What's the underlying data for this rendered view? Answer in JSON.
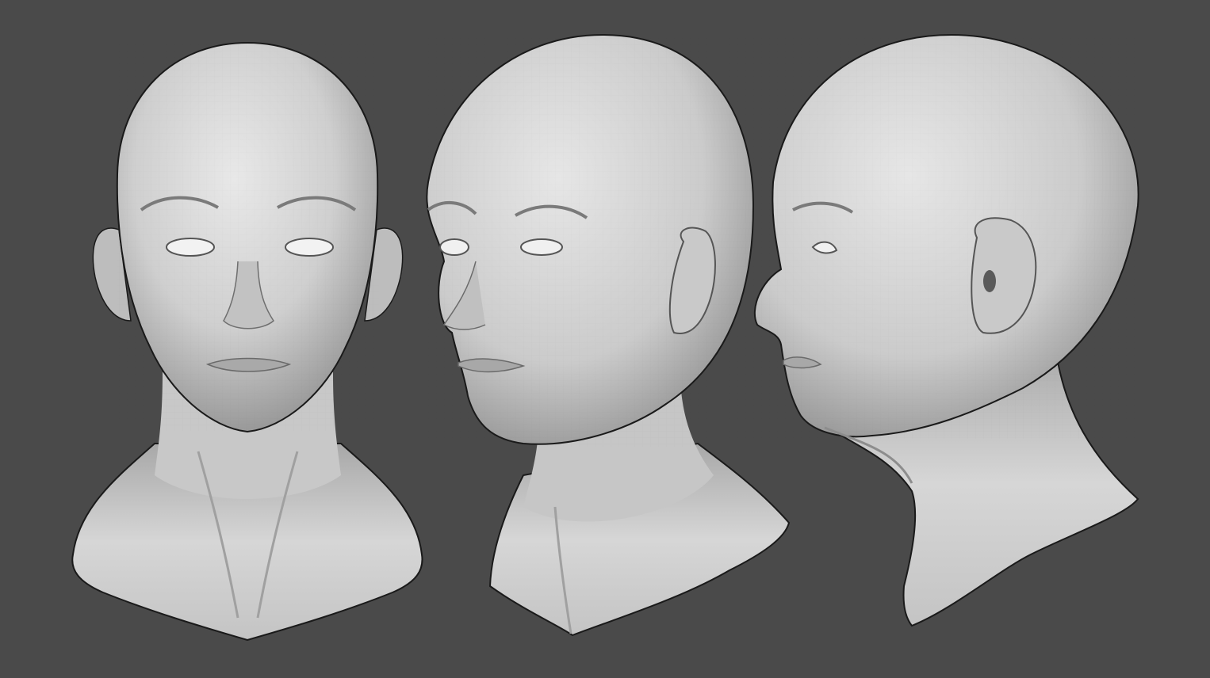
{
  "scene": {
    "background_color": "#4a4a4a",
    "material_color": "#d9d9d9",
    "outline_color": "#1a1a1a",
    "views": [
      {
        "id": "front",
        "label": ""
      },
      {
        "id": "three-quarter",
        "label": ""
      },
      {
        "id": "profile",
        "label": ""
      }
    ]
  }
}
